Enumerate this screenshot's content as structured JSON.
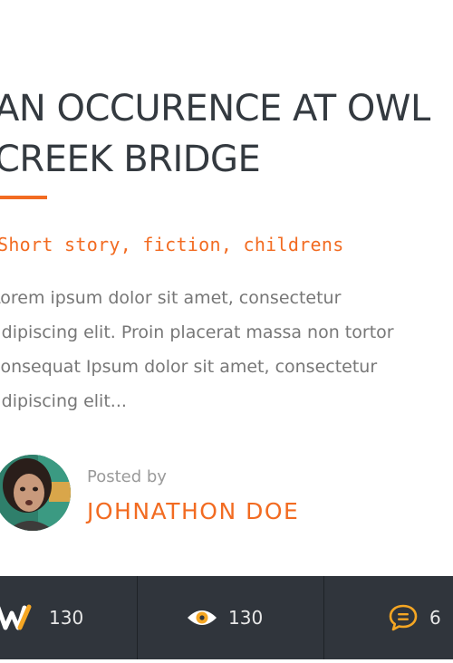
{
  "post": {
    "title_lines": [
      "AN OCCURENCE AT OWL",
      "CREEK BRIDGE"
    ],
    "categories": "Short story, fiction, childrens",
    "excerpt_lines": [
      "Lorem ipsum dolor sit amet, consectetur",
      "adipiscing elit. Proin placerat massa non tortor",
      "consequat Ipsum dolor sit amet, consectetur",
      "adipiscing elit..."
    ]
  },
  "author": {
    "posted_by_label": "Posted by",
    "name": "JOHNATHON DOE"
  },
  "stats": {
    "likes": {
      "icon": "w-logo-icon",
      "count": "130"
    },
    "views": {
      "icon": "eye-icon",
      "count": "130"
    },
    "comments": {
      "icon": "comment-icon",
      "count": "6"
    }
  },
  "colors": {
    "accent": "#f26b21",
    "title": "#343a40",
    "body_text": "#777777",
    "stats_bar": "#30353c"
  }
}
